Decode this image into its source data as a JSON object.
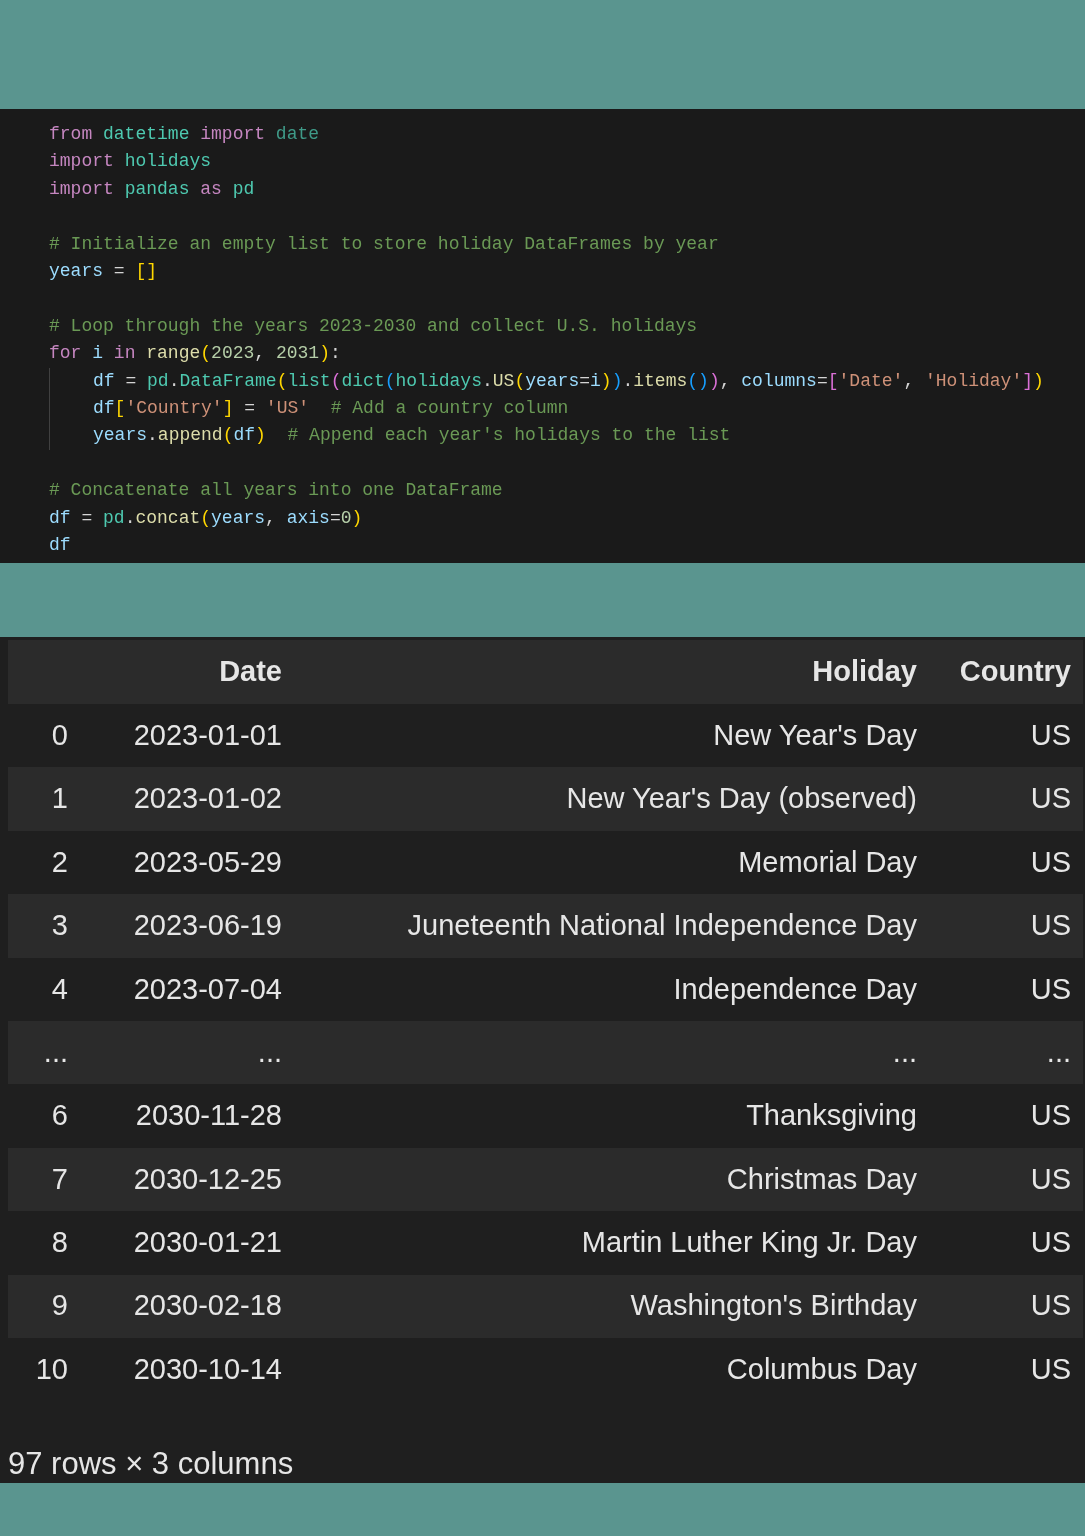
{
  "code_lines": [
    {
      "kind": "code",
      "indented": false,
      "tokens": [
        {
          "text": "from ",
          "kind": "kw"
        },
        {
          "text": "datetime ",
          "kind": "mod"
        },
        {
          "text": "import ",
          "kind": "kw"
        },
        {
          "text": "date",
          "kind": "dim"
        }
      ]
    },
    {
      "kind": "code",
      "indented": false,
      "tokens": [
        {
          "text": "import ",
          "kind": "kw"
        },
        {
          "text": "holidays",
          "kind": "mod"
        }
      ]
    },
    {
      "kind": "code",
      "indented": false,
      "tokens": [
        {
          "text": "import ",
          "kind": "kw"
        },
        {
          "text": "pandas ",
          "kind": "mod"
        },
        {
          "text": "as ",
          "kind": "kw"
        },
        {
          "text": "pd",
          "kind": "mod"
        }
      ]
    },
    {
      "kind": "blank"
    },
    {
      "kind": "code",
      "indented": false,
      "tokens": [
        {
          "text": "# Initialize an empty list to store holiday DataFrames by year",
          "kind": "com"
        }
      ]
    },
    {
      "kind": "code",
      "indented": false,
      "tokens": [
        {
          "text": "years",
          "kind": "var"
        },
        {
          "text": " = ",
          "kind": "op"
        },
        {
          "text": "[]",
          "kind": "b1"
        }
      ]
    },
    {
      "kind": "blank"
    },
    {
      "kind": "code",
      "indented": false,
      "tokens": [
        {
          "text": "# Loop through the years 2023-2030 and collect U.S. holidays",
          "kind": "com"
        }
      ]
    },
    {
      "kind": "code",
      "indented": false,
      "tokens": [
        {
          "text": "for ",
          "kind": "kw"
        },
        {
          "text": "i",
          "kind": "var"
        },
        {
          "text": " in ",
          "kind": "kw"
        },
        {
          "text": "range",
          "kind": "fn"
        },
        {
          "text": "(",
          "kind": "b1"
        },
        {
          "text": "2023",
          "kind": "num"
        },
        {
          "text": ", ",
          "kind": "op"
        },
        {
          "text": "2031",
          "kind": "num"
        },
        {
          "text": ")",
          "kind": "b1"
        },
        {
          "text": ":",
          "kind": "op"
        }
      ]
    },
    {
      "kind": "code",
      "indented": true,
      "tokens": [
        {
          "text": "df",
          "kind": "var"
        },
        {
          "text": " = ",
          "kind": "op"
        },
        {
          "text": "pd",
          "kind": "mod"
        },
        {
          "text": ".",
          "kind": "op"
        },
        {
          "text": "DataFrame",
          "kind": "mod"
        },
        {
          "text": "(",
          "kind": "b1"
        },
        {
          "text": "list",
          "kind": "mod"
        },
        {
          "text": "(",
          "kind": "b2"
        },
        {
          "text": "dict",
          "kind": "mod"
        },
        {
          "text": "(",
          "kind": "b3"
        },
        {
          "text": "holidays",
          "kind": "mod"
        },
        {
          "text": ".",
          "kind": "op"
        },
        {
          "text": "US",
          "kind": "fn"
        },
        {
          "text": "(",
          "kind": "b1"
        },
        {
          "text": "years",
          "kind": "var"
        },
        {
          "text": "=",
          "kind": "op"
        },
        {
          "text": "i",
          "kind": "var"
        },
        {
          "text": ")",
          "kind": "b1"
        },
        {
          "text": ")",
          "kind": "b3"
        },
        {
          "text": ".",
          "kind": "op"
        },
        {
          "text": "items",
          "kind": "fn"
        },
        {
          "text": "()",
          "kind": "b3"
        },
        {
          "text": ")",
          "kind": "b2"
        },
        {
          "text": ", ",
          "kind": "op"
        },
        {
          "text": "columns",
          "kind": "var"
        },
        {
          "text": "=",
          "kind": "op"
        },
        {
          "text": "[",
          "kind": "b2"
        },
        {
          "text": "'Date'",
          "kind": "str"
        },
        {
          "text": ", ",
          "kind": "op"
        },
        {
          "text": "'Holiday'",
          "kind": "str"
        },
        {
          "text": "]",
          "kind": "b2"
        },
        {
          "text": ")",
          "kind": "b1"
        }
      ]
    },
    {
      "kind": "code",
      "indented": true,
      "tokens": [
        {
          "text": "df",
          "kind": "var"
        },
        {
          "text": "[",
          "kind": "b1"
        },
        {
          "text": "'Country'",
          "kind": "str"
        },
        {
          "text": "]",
          "kind": "b1"
        },
        {
          "text": " = ",
          "kind": "op"
        },
        {
          "text": "'US'",
          "kind": "str"
        },
        {
          "text": "  # Add a country column",
          "kind": "com"
        }
      ]
    },
    {
      "kind": "code",
      "indented": true,
      "tokens": [
        {
          "text": "years",
          "kind": "var"
        },
        {
          "text": ".",
          "kind": "op"
        },
        {
          "text": "append",
          "kind": "fn"
        },
        {
          "text": "(",
          "kind": "b1"
        },
        {
          "text": "df",
          "kind": "var"
        },
        {
          "text": ")",
          "kind": "b1"
        },
        {
          "text": "  # Append each year's holidays to the list",
          "kind": "com"
        }
      ]
    },
    {
      "kind": "blank"
    },
    {
      "kind": "code",
      "indented": false,
      "tokens": [
        {
          "text": "# Concatenate all years into one DataFrame",
          "kind": "com"
        }
      ]
    },
    {
      "kind": "code",
      "indented": false,
      "tokens": [
        {
          "text": "df",
          "kind": "var"
        },
        {
          "text": " = ",
          "kind": "op"
        },
        {
          "text": "pd",
          "kind": "mod"
        },
        {
          "text": ".",
          "kind": "op"
        },
        {
          "text": "concat",
          "kind": "fn"
        },
        {
          "text": "(",
          "kind": "b1"
        },
        {
          "text": "years",
          "kind": "var"
        },
        {
          "text": ", ",
          "kind": "op"
        },
        {
          "text": "axis",
          "kind": "var"
        },
        {
          "text": "=",
          "kind": "op"
        },
        {
          "text": "0",
          "kind": "num"
        },
        {
          "text": ")",
          "kind": "b1"
        }
      ]
    },
    {
      "kind": "code",
      "indented": false,
      "tokens": [
        {
          "text": "df",
          "kind": "var"
        }
      ]
    }
  ],
  "table": {
    "columns": [
      "Date",
      "Holiday",
      "Country"
    ],
    "rows": [
      {
        "index": "0",
        "cells": [
          "2023-01-01",
          "New Year's Day",
          "US"
        ]
      },
      {
        "index": "1",
        "cells": [
          "2023-01-02",
          "New Year's Day (observed)",
          "US"
        ]
      },
      {
        "index": "2",
        "cells": [
          "2023-05-29",
          "Memorial Day",
          "US"
        ]
      },
      {
        "index": "3",
        "cells": [
          "2023-06-19",
          "Juneteenth National Independence Day",
          "US"
        ]
      },
      {
        "index": "4",
        "cells": [
          "2023-07-04",
          "Independence Day",
          "US"
        ]
      },
      {
        "index": "...",
        "cells": [
          "...",
          "...",
          "..."
        ]
      },
      {
        "index": "6",
        "cells": [
          "2030-11-28",
          "Thanksgiving",
          "US"
        ]
      },
      {
        "index": "7",
        "cells": [
          "2030-12-25",
          "Christmas Day",
          "US"
        ]
      },
      {
        "index": "8",
        "cells": [
          "2030-01-21",
          "Martin Luther King Jr. Day",
          "US"
        ]
      },
      {
        "index": "9",
        "cells": [
          "2030-02-18",
          "Washington's Birthday",
          "US"
        ]
      },
      {
        "index": "10",
        "cells": [
          "2030-10-14",
          "Columbus Day",
          "US"
        ]
      }
    ],
    "footer": "97 rows × 3 columns"
  }
}
